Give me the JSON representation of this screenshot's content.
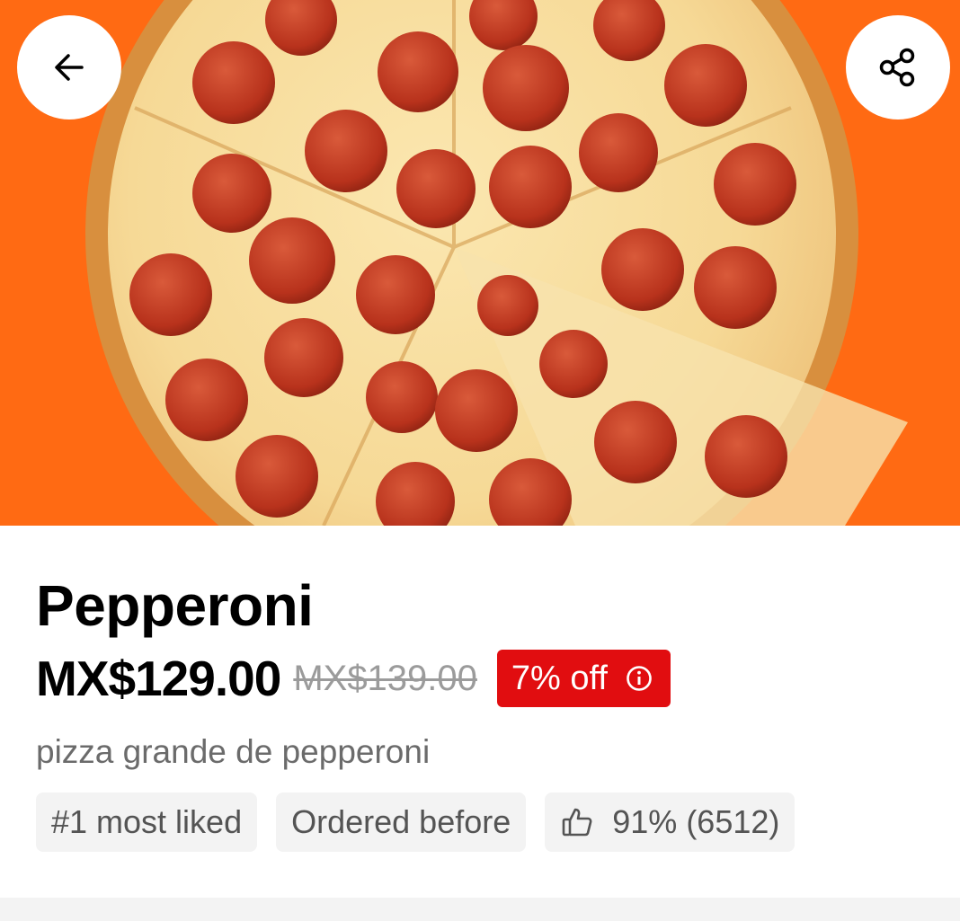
{
  "header": {
    "hero_image": "pepperoni-pizza-photo",
    "back_icon": "arrow-left-icon",
    "share_icon": "share-icon"
  },
  "item": {
    "name": "Pepperoni",
    "price": "MX$129.00",
    "original_price": "MX$139.00",
    "discount_label": "7% off",
    "discount_icon": "info-icon",
    "description": "pizza grande de pepperoni"
  },
  "tags": [
    {
      "label": "#1 most liked"
    },
    {
      "label": "Ordered before"
    },
    {
      "label": "91% (6512)",
      "icon": "thumbs-up-icon"
    }
  ],
  "colors": {
    "hero_background": "#ff6a13",
    "discount_badge": "#e10d10",
    "chip_background": "#f3f3f3",
    "secondary_text": "#6b6b6b"
  }
}
